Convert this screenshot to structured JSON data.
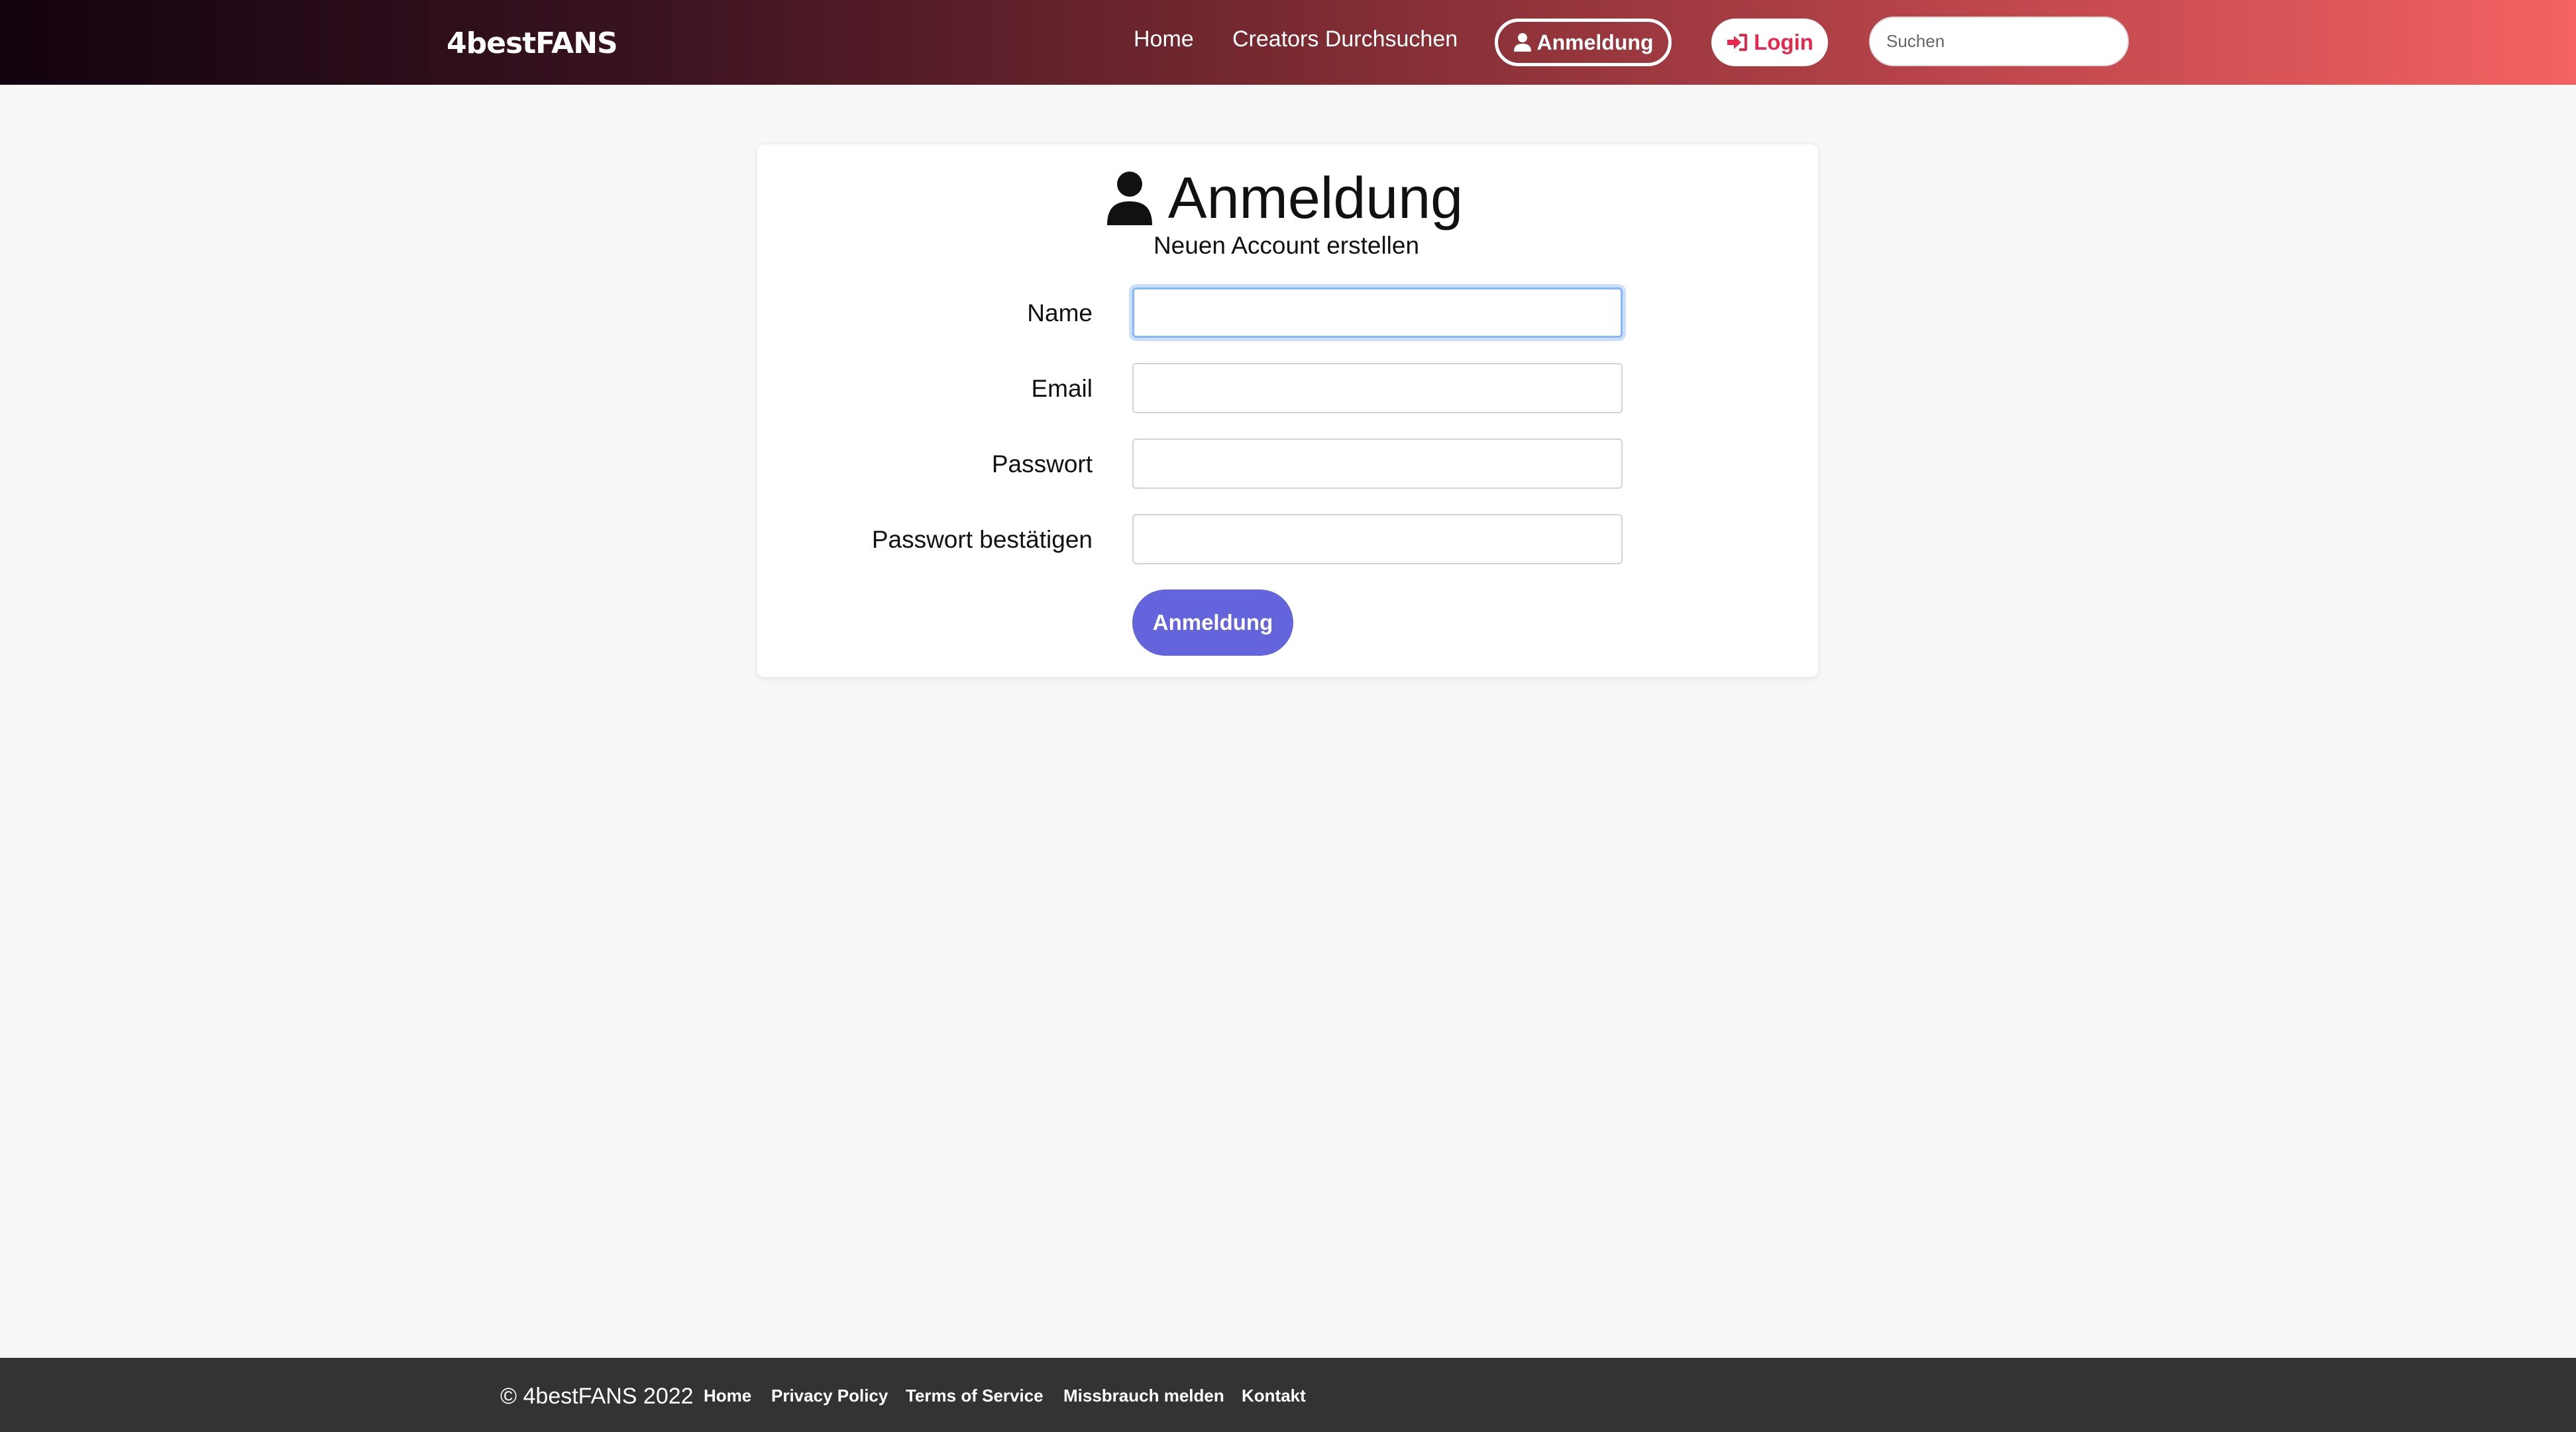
{
  "header": {
    "brand": "4bestFANS",
    "nav": {
      "home": "Home",
      "creators": "Creators Durchsuchen",
      "register": "Anmeldung",
      "login": "Login"
    },
    "search": {
      "placeholder": "Suchen",
      "value": ""
    }
  },
  "form": {
    "title": "Anmeldung",
    "subtitle": "Neuen Account erstellen",
    "fields": [
      {
        "label": "Name",
        "value": ""
      },
      {
        "label": "Email",
        "value": ""
      },
      {
        "label": "Passwort",
        "value": ""
      },
      {
        "label": "Passwort bestätigen",
        "value": ""
      }
    ],
    "submit": "Anmeldung"
  },
  "footer": {
    "copyright": "© 4bestFANS 2022",
    "links": [
      "Home",
      "Privacy Policy",
      "Terms of Service",
      "Missbrauch melden",
      "Kontakt"
    ]
  },
  "colors": {
    "header_gradient_start": "#12030f",
    "header_gradient_end": "#f46262",
    "login_accent": "#e8294d",
    "submit_button": "#6464dc",
    "footer_bg": "#333333",
    "page_bg": "#f7f7f7"
  },
  "icons": {
    "register": "user-icon",
    "login": "sign-in-icon",
    "title": "user-icon"
  }
}
